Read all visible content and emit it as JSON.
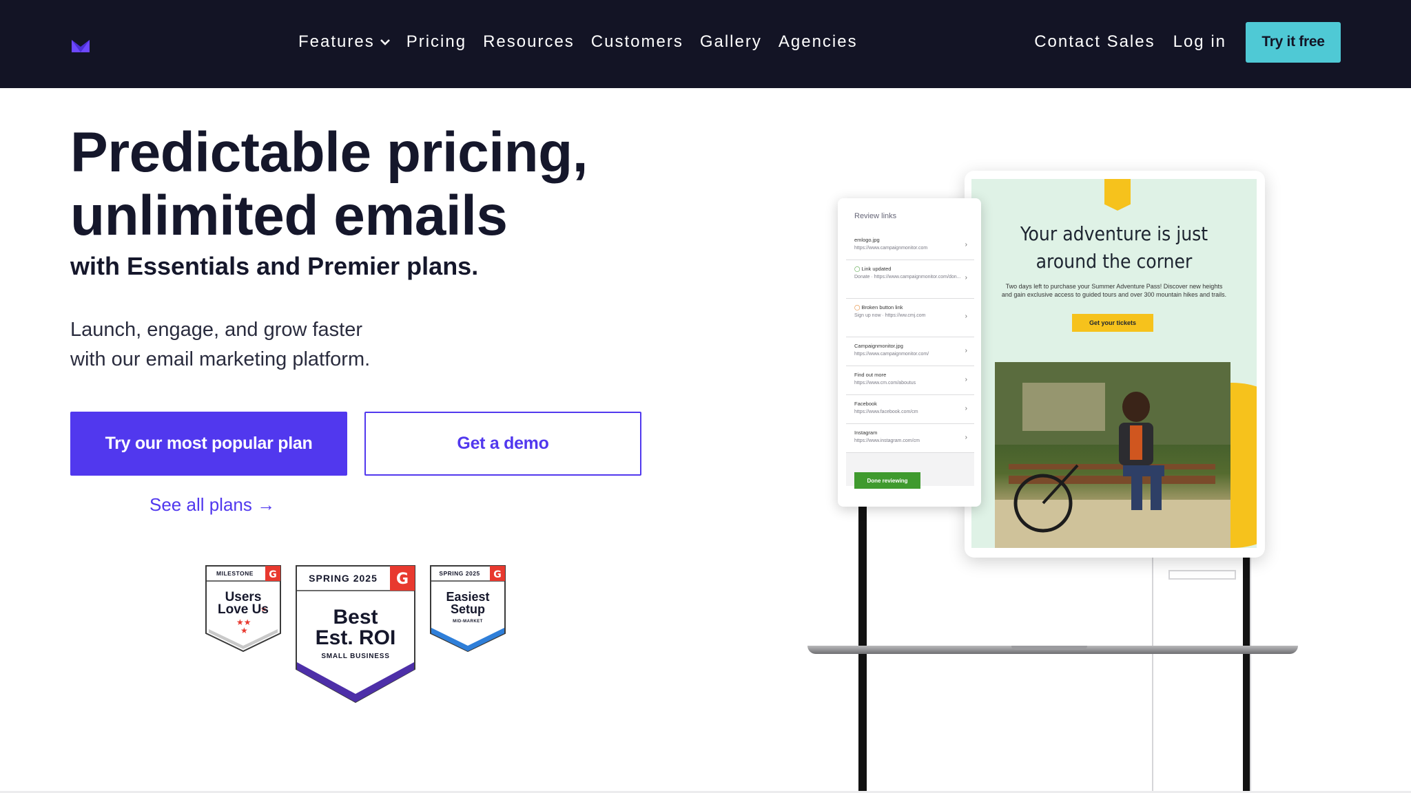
{
  "nav": {
    "links": [
      "Features",
      "Pricing",
      "Resources",
      "Customers",
      "Gallery",
      "Agencies"
    ],
    "contact_sales": "Contact Sales",
    "log_in": "Log in",
    "try_free": "Try it free",
    "colors": {
      "bg": "#131425",
      "cta": "#4fc9d5",
      "logo": "#6d48ff"
    }
  },
  "hero": {
    "title_line1": "Predictable pricing,",
    "title_line2": "unlimited emails",
    "subtitle": "with Essentials and Premier plans.",
    "desc_line1": "Launch, engage, and grow faster",
    "desc_line2": "with our email marketing platform.",
    "primary_cta": "Try our most popular plan",
    "secondary_cta": "Get a demo",
    "see_all": "See all plans →",
    "accent": "#5138ee"
  },
  "badges": [
    {
      "top": "MILESTONE",
      "line1": "Users",
      "line2": "Love Us",
      "bottom": "",
      "rating": "2 stars"
    },
    {
      "top": "SPRING 2025",
      "line1": "Best",
      "line2": "Est. ROI",
      "bottom": "SMALL BUSINESS"
    },
    {
      "top": "SPRING 2025",
      "line1": "Easiest",
      "line2": "Setup",
      "bottom": "MID-MARKET"
    }
  ],
  "illustration": {
    "review_title": "Review links",
    "review_rows": [
      {
        "label": "emlogo.jpg",
        "url": "https://www.campaignmonitor.com"
      },
      {
        "label": "Link updated",
        "url": "Donate · https://www.campaignmonitor.com/don..."
      },
      {
        "label": "Broken button link",
        "url": "Sign up now · https://ww.cmj.com"
      },
      {
        "label": "Campaignmonitor.jpg",
        "url": "https://www.campaignmonitor.com/"
      },
      {
        "label": "Find out more",
        "url": "https://www.cm.com/aboutus"
      },
      {
        "label": "Facebook",
        "url": "https://www.facebook.com/cm"
      },
      {
        "label": "Instagram",
        "url": "https://www.instagram.com/cm"
      }
    ],
    "done_button": "Done reviewing",
    "email_title_line1": "Your adventure is just",
    "email_title_line2": "around the corner",
    "email_body": "Two days left to purchase your Summer Adventure Pass! Discover new heights and gain exclusive access to guided tours and over 300 mountain hikes and trails.",
    "email_cta": "Get your tickets",
    "colors": {
      "email_bg": "#dff2e6",
      "yellow": "#f6c21c",
      "done": "#3f9a2e"
    }
  }
}
